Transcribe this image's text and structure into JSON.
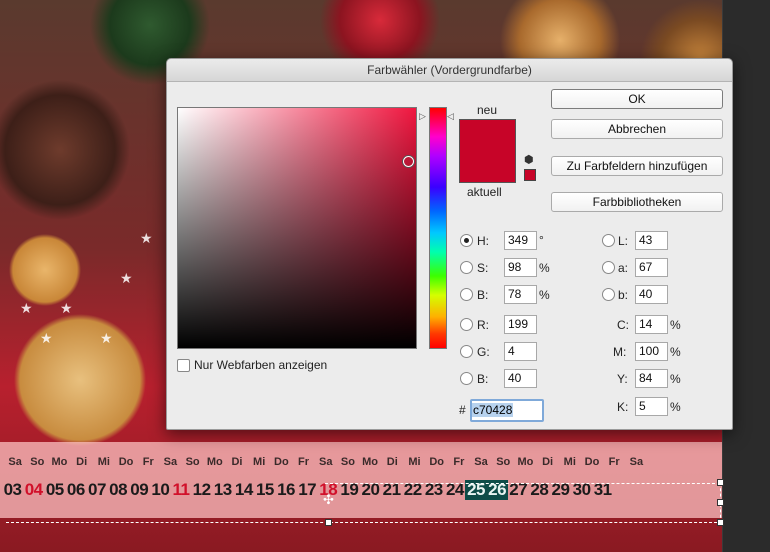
{
  "dialog": {
    "title": "Farbwähler (Vordergrundfarbe)",
    "ok_label": "OK",
    "cancel_label": "Abbrechen",
    "add_swatch_label": "Zu Farbfeldern hinzufügen",
    "libraries_label": "Farbbibliotheken",
    "new_label": "neu",
    "current_label": "aktuell",
    "webcolors_label": "Nur Webfarben anzeigen",
    "webcolors_checked": false,
    "current_color": "#c70428",
    "selected_mode": "H",
    "hex_prefix": "#",
    "hex_value": "c70428",
    "hsb": {
      "h_label": "H:",
      "h_value": "349",
      "h_unit": "°",
      "s_label": "S:",
      "s_value": "98",
      "s_unit": "%",
      "b_label": "B:",
      "b_value": "78",
      "b_unit": "%"
    },
    "rgb": {
      "r_label": "R:",
      "r_value": "199",
      "g_label": "G:",
      "g_value": "4",
      "b_label": "B:",
      "b_value": "40"
    },
    "lab": {
      "l_label": "L:",
      "l_value": "43",
      "a_label": "a:",
      "a_value": "67",
      "b_label": "b:",
      "b_value": "40"
    },
    "cmyk": {
      "c_label": "C:",
      "c_value": "14",
      "c_unit": "%",
      "m_label": "M:",
      "m_value": "100",
      "m_unit": "%",
      "y_label": "Y:",
      "y_value": "84",
      "y_unit": "%",
      "k_label": "K:",
      "k_value": "5",
      "k_unit": "%"
    }
  },
  "calendar": {
    "day_names": [
      "Sa",
      "So",
      "Mo",
      "Di",
      "Mi",
      "Do",
      "Fr",
      "Sa",
      "So",
      "Mo",
      "Di",
      "Mi",
      "Do",
      "Fr",
      "Sa",
      "So",
      "Mo",
      "Di",
      "Mi",
      "Do",
      "Fr",
      "Sa",
      "So",
      "Mo",
      "Di",
      "Mi",
      "Do",
      "Fr",
      "Sa"
    ],
    "days": [
      {
        "n": "03",
        "s": ""
      },
      {
        "n": "04",
        "s": "red"
      },
      {
        "n": "05",
        "s": ""
      },
      {
        "n": "06",
        "s": ""
      },
      {
        "n": "07",
        "s": ""
      },
      {
        "n": "08",
        "s": ""
      },
      {
        "n": "09",
        "s": ""
      },
      {
        "n": "10",
        "s": ""
      },
      {
        "n": "11",
        "s": "red"
      },
      {
        "n": "12",
        "s": ""
      },
      {
        "n": "13",
        "s": ""
      },
      {
        "n": "14",
        "s": ""
      },
      {
        "n": "15",
        "s": ""
      },
      {
        "n": "16",
        "s": ""
      },
      {
        "n": "17",
        "s": ""
      },
      {
        "n": "18",
        "s": "red"
      },
      {
        "n": "19",
        "s": ""
      },
      {
        "n": "20",
        "s": ""
      },
      {
        "n": "21",
        "s": ""
      },
      {
        "n": "22",
        "s": ""
      },
      {
        "n": "23",
        "s": ""
      },
      {
        "n": "24",
        "s": ""
      },
      {
        "n": "25",
        "s": "hl"
      },
      {
        "n": "26",
        "s": "hl"
      },
      {
        "n": "27",
        "s": ""
      },
      {
        "n": "28",
        "s": ""
      },
      {
        "n": "29",
        "s": ""
      },
      {
        "n": "30",
        "s": ""
      },
      {
        "n": "31",
        "s": ""
      }
    ]
  },
  "colors": {
    "highlight": "#0e4c48",
    "sunday_red": "#d1102a"
  },
  "icons": [
    "picker-circle-icon",
    "hue-slider-arrow-icon",
    "websafe-cube-icon",
    "transform-handle-icon"
  ]
}
